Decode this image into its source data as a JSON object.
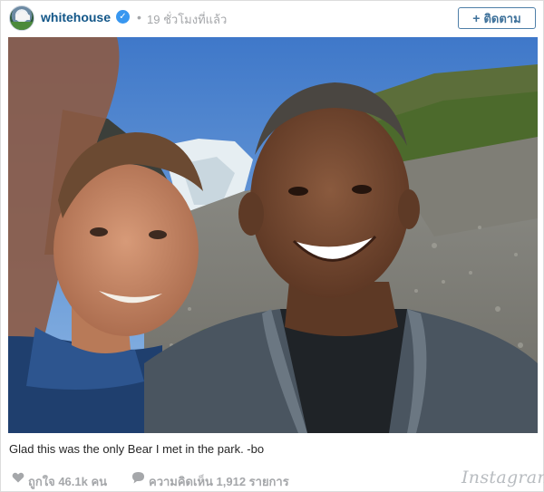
{
  "post": {
    "username": "whitehouse",
    "verified_glyph": "✓",
    "separator": "•",
    "timestamp": "19 ชั่วโมงที่แล้ว",
    "follow_plus": "+",
    "follow_label": "ติดตาม",
    "caption": "Glad this was the only Bear I met in the park. -bo",
    "likes": "ถูกใจ 46.1k คน",
    "comments": "ความคิดเห็น 1,912 รายการ",
    "brand": "Instagram"
  },
  "icons": {
    "avatar": "whitehouse-building-avatar",
    "verified": "verified-check-icon",
    "heart": "heart-icon",
    "comment": "speech-bubble-icon"
  },
  "colors": {
    "username": "#125688",
    "verified": "#3897f0",
    "muted": "#a5a7aa",
    "follow_border": "#4f7fa8"
  }
}
